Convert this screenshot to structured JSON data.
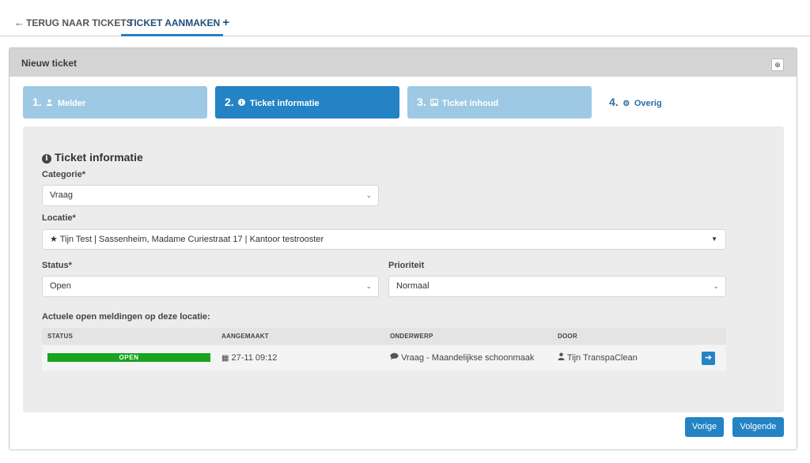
{
  "nav": {
    "back_label": "TERUG NAAR TICKETS",
    "back_icon": "arrow-left-icon",
    "create_label": "TICKET AANMAKEN",
    "create_icon": "plus-icon",
    "accent_color": "#2a7fbf"
  },
  "panel": {
    "title": "Nieuw ticket",
    "zoom_icon": "zoom-in-icon"
  },
  "steps": [
    {
      "num": "1.",
      "label": "Melder",
      "icon": "user-icon",
      "state": "done"
    },
    {
      "num": "2.",
      "label": "Ticket informatie",
      "icon": "info-icon",
      "state": "active"
    },
    {
      "num": "3.",
      "label": "Ticket inhoud",
      "icon": "image-icon",
      "state": "upcoming"
    },
    {
      "num": "4.",
      "label": "Overig",
      "icon": "gear-icon",
      "state": "upcoming"
    }
  ],
  "form": {
    "section_title": "Ticket informatie",
    "categorie_label": "Categorie*",
    "categorie_value": "Vraag",
    "locatie_label": "Locatie*",
    "locatie_value": "★ Tijn Test | Sassenheim, Madame Curiestraat 17 | Kantoor testrooster",
    "status_label": "Status*",
    "status_value": "Open",
    "prioriteit_label": "Prioriteit",
    "prioriteit_value": "Normaal"
  },
  "table": {
    "title": "Actuele open meldingen op deze locatie:",
    "headers": [
      "STATUS",
      "AANGEMAAKT",
      "ONDERWERP",
      "DOOR"
    ],
    "rows": [
      {
        "status": "OPEN",
        "aangemaakt": "27-11 09:12",
        "onderwerp": "Vraag - Maandelijkse schoonmaak",
        "door": "Tijn TranspaClean"
      }
    ],
    "status_color": "#1aa31f"
  },
  "buttons": {
    "prev": "Vorige",
    "next": "Volgende",
    "color": "#2383c4"
  }
}
